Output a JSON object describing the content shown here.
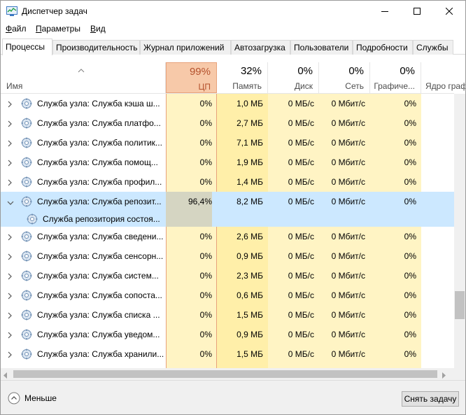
{
  "window": {
    "title": "Диспетчер задач"
  },
  "menu": {
    "file": {
      "u": "Ф",
      "rest": "айл"
    },
    "params": {
      "u": "П",
      "rest": "араметры"
    },
    "view": {
      "u": "В",
      "rest": "ид"
    }
  },
  "tabs": [
    "Процессы",
    "Производительность",
    "Журнал приложений",
    "Автозагрузка",
    "Пользователи",
    "Подробности",
    "Службы"
  ],
  "columns": {
    "name": "Имя",
    "cpu": {
      "pct": "99%",
      "label": "ЦП"
    },
    "memory": {
      "pct": "32%",
      "label": "Память"
    },
    "disk": {
      "pct": "0%",
      "label": "Диск"
    },
    "network": {
      "pct": "0%",
      "label": "Сеть"
    },
    "gpu": {
      "pct": "0%",
      "label": "Графиче..."
    },
    "gpu_engine": {
      "label": "Ядро граф"
    }
  },
  "rows": [
    {
      "name": "Служба узла: Служба кэша ш...",
      "cpu": "0%",
      "mem": "1,0 МБ",
      "disk": "0 МБ/с",
      "net": "0 Мбит/с",
      "gpu": "0%"
    },
    {
      "name": "Служба узла: Служба платфо...",
      "cpu": "0%",
      "mem": "2,7 МБ",
      "disk": "0 МБ/с",
      "net": "0 Мбит/с",
      "gpu": "0%"
    },
    {
      "name": "Служба узла: Служба политик...",
      "cpu": "0%",
      "mem": "7,1 МБ",
      "disk": "0 МБ/с",
      "net": "0 Мбит/с",
      "gpu": "0%"
    },
    {
      "name": "Служба узла: Служба помощ...",
      "cpu": "0%",
      "mem": "1,9 МБ",
      "disk": "0 МБ/с",
      "net": "0 Мбит/с",
      "gpu": "0%"
    },
    {
      "name": "Служба узла: Служба профил...",
      "cpu": "0%",
      "mem": "1,4 МБ",
      "disk": "0 МБ/с",
      "net": "0 Мбит/с",
      "gpu": "0%"
    },
    {
      "name": "Служба узла: Служба репозит...",
      "cpu": "96,4%",
      "mem": "8,2 МБ",
      "disk": "0 МБ/с",
      "net": "0 Мбит/с",
      "gpu": "0%"
    },
    {
      "name": "Служба узла: Служба сведени...",
      "cpu": "0%",
      "mem": "2,6 МБ",
      "disk": "0 МБ/с",
      "net": "0 Мбит/с",
      "gpu": "0%"
    },
    {
      "name": "Служба узла: Служба сенсорн...",
      "cpu": "0%",
      "mem": "0,9 МБ",
      "disk": "0 МБ/с",
      "net": "0 Мбит/с",
      "gpu": "0%"
    },
    {
      "name": "Служба узла: Служба систем...",
      "cpu": "0%",
      "mem": "2,3 МБ",
      "disk": "0 МБ/с",
      "net": "0 Мбит/с",
      "gpu": "0%"
    },
    {
      "name": "Служба узла: Служба сопоста...",
      "cpu": "0%",
      "mem": "0,6 МБ",
      "disk": "0 МБ/с",
      "net": "0 Мбит/с",
      "gpu": "0%"
    },
    {
      "name": "Служба узла: Служба списка ...",
      "cpu": "0%",
      "mem": "1,5 МБ",
      "disk": "0 МБ/с",
      "net": "0 Мбит/с",
      "gpu": "0%"
    },
    {
      "name": "Служба узла: Служба уведом...",
      "cpu": "0%",
      "mem": "0,9 МБ",
      "disk": "0 МБ/с",
      "net": "0 Мбит/с",
      "gpu": "0%"
    },
    {
      "name": "Служба узла: Служба хранили...",
      "cpu": "0%",
      "mem": "1,5 МБ",
      "disk": "0 МБ/с",
      "net": "0 Мбит/с",
      "gpu": "0%"
    }
  ],
  "child_row": {
    "name": "Служба репозитория состоя..."
  },
  "footer": {
    "less_label": "Меньше",
    "end_task_label": "Снять задачу"
  },
  "colors": {
    "cpu_header": "#f7c9a9",
    "cpu_column": "#fff4c4",
    "mem_column": "#ffefa9",
    "selected_row": "#cce8ff"
  }
}
